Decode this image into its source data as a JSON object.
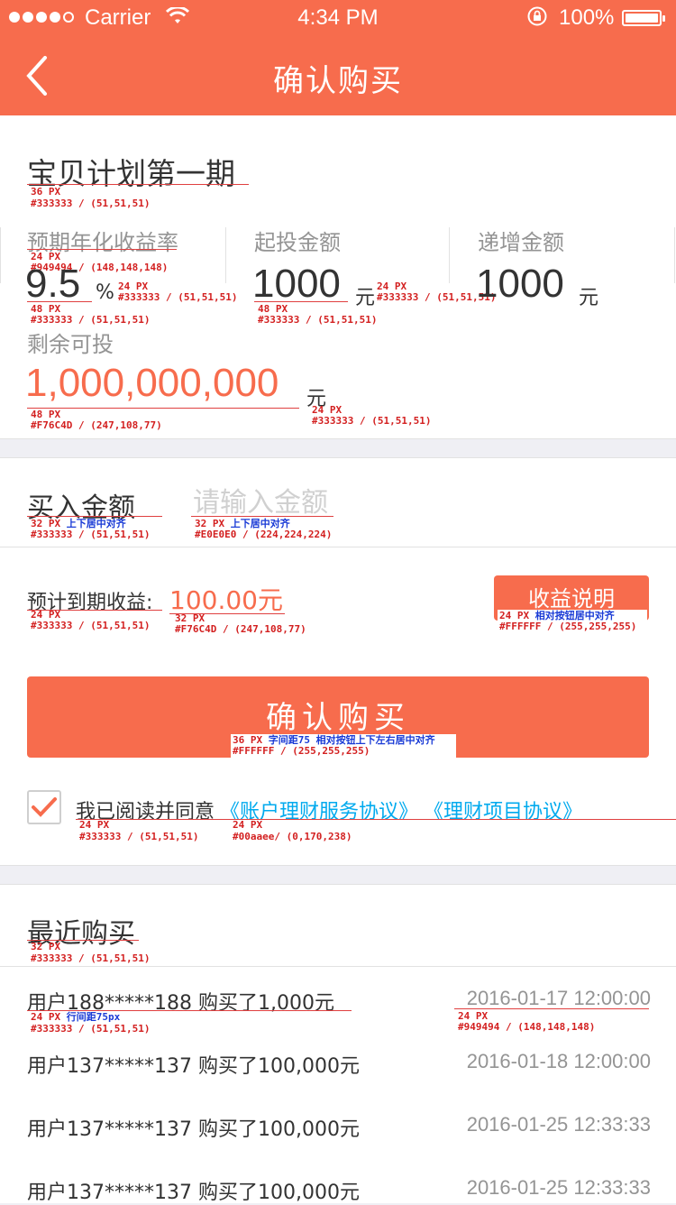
{
  "status_bar": {
    "carrier": "Carrier",
    "time": "4:34 PM",
    "battery": "100%",
    "signal_icon": "signal-dots-icon",
    "wifi_icon": "wifi-icon",
    "lock_icon": "rotation-lock-icon"
  },
  "header": {
    "title": "确认购买",
    "back_icon": "chevron-left-icon"
  },
  "colors": {
    "accent": "#F76C4D",
    "text": "#333333",
    "muted": "#949494",
    "placeholder": "#E0E0E0",
    "link": "#00aaee"
  },
  "product": {
    "name": "宝贝计划第一期",
    "rate_label": "预期年化收益率",
    "rate_value": "9.5",
    "rate_unit": "%",
    "min_label": "起投金额",
    "min_value": "1000",
    "min_unit": "元",
    "step_label": "递增金额",
    "step_value": "1000",
    "step_unit": "元",
    "remain_label": "剩余可投",
    "remain_value": "1,000,000,000",
    "remain_unit": "元"
  },
  "buy": {
    "label": "买入金额",
    "input_placeholder": "请输入金额",
    "expected_label": "预计到期收益:",
    "expected_value": "100.00元",
    "note_button": "收益说明",
    "confirm_button": "确认购买",
    "agree_text": "我已阅读并同意",
    "agreement_1": "《账户理财服务协议》",
    "agreement_2": "《理财项目协议》",
    "checkbox_checked": true
  },
  "recent": {
    "title": "最近购买",
    "records": [
      {
        "user": "用户188*****188 购买了1,000元",
        "time": "2016-01-17 12:00:00"
      },
      {
        "user": "用户137*****137 购买了100,000元",
        "time": "2016-01-18 12:00:00"
      },
      {
        "user": "用户137*****137 购买了100,000元",
        "time": "2016-01-25 12:33:33"
      },
      {
        "user": "用户137*****137 购买了100,000元",
        "time": "2016-01-25 12:33:33"
      }
    ]
  },
  "annotations": {
    "title_size": "36 PX",
    "color_333": "#333333 / (51,51,51)",
    "px_24": "24 PX",
    "color_949494": "#949494 / (148,148,148)",
    "px_48": "48 PX",
    "color_f76c4d": "#F76C4D / (247,108,77)",
    "px_32": "32 PX",
    "center_v": "上下居中对齐",
    "color_e0e0e0": "#E0E0E0 / (224,224,224)",
    "btn_note_spec": "相对按钮居中对齐",
    "color_fff": "#FFFFFF / (255,255,255)",
    "confirm_spec_px": "36 PX",
    "confirm_spec": "字间距75 相对按钮上下左右居中对齐",
    "color_00aaee": "#00aaee/ (0,170,238)",
    "line_spacing": "行间距75px"
  }
}
